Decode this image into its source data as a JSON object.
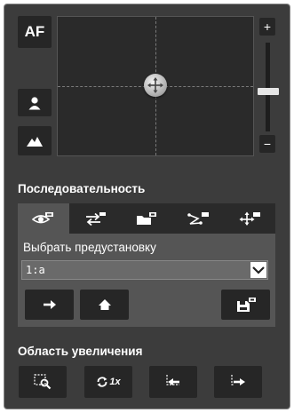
{
  "ptz": {
    "af_label": "AF",
    "zoom_plus": "+",
    "zoom_minus": "−",
    "zoom_level_fraction": 0.55
  },
  "sequence": {
    "title": "Последовательность",
    "tabs": [
      {
        "icon": "eye-icon",
        "active": true
      },
      {
        "icon": "swap-icon",
        "active": false
      },
      {
        "icon": "folder-icon",
        "active": false
      },
      {
        "icon": "route-icon",
        "active": false
      },
      {
        "icon": "move-icon",
        "active": false
      }
    ],
    "preset_label": "Выбрать предустановку",
    "preset_value": "1:a"
  },
  "zoom_area": {
    "title": "Область увеличения",
    "rate_label": "1x"
  },
  "colors": {
    "panel_bg": "#3c3c3c",
    "button_bg": "#262626",
    "active_tab": "#555555",
    "text": "#ffffff"
  }
}
